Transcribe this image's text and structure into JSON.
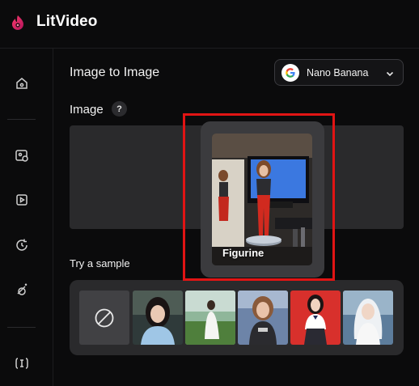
{
  "app": {
    "title": "LitVideo"
  },
  "main": {
    "title": "Image to Image",
    "model": {
      "label": "Nano Banana",
      "icon": "google-g-icon"
    },
    "image_section": {
      "label": "Image",
      "help": "?"
    },
    "sample_section": {
      "label": "Try a sample"
    }
  },
  "preview": {
    "label": "Figurine"
  },
  "sidebar": {
    "icons": [
      "home-icon",
      "image-edit-icon",
      "video-icon",
      "refresh-icon",
      "magic-icon",
      "text-cursor-icon"
    ]
  },
  "colors": {
    "accent": "#e11414",
    "background": "#0b0b0c",
    "panel": "#2a2a2c"
  }
}
